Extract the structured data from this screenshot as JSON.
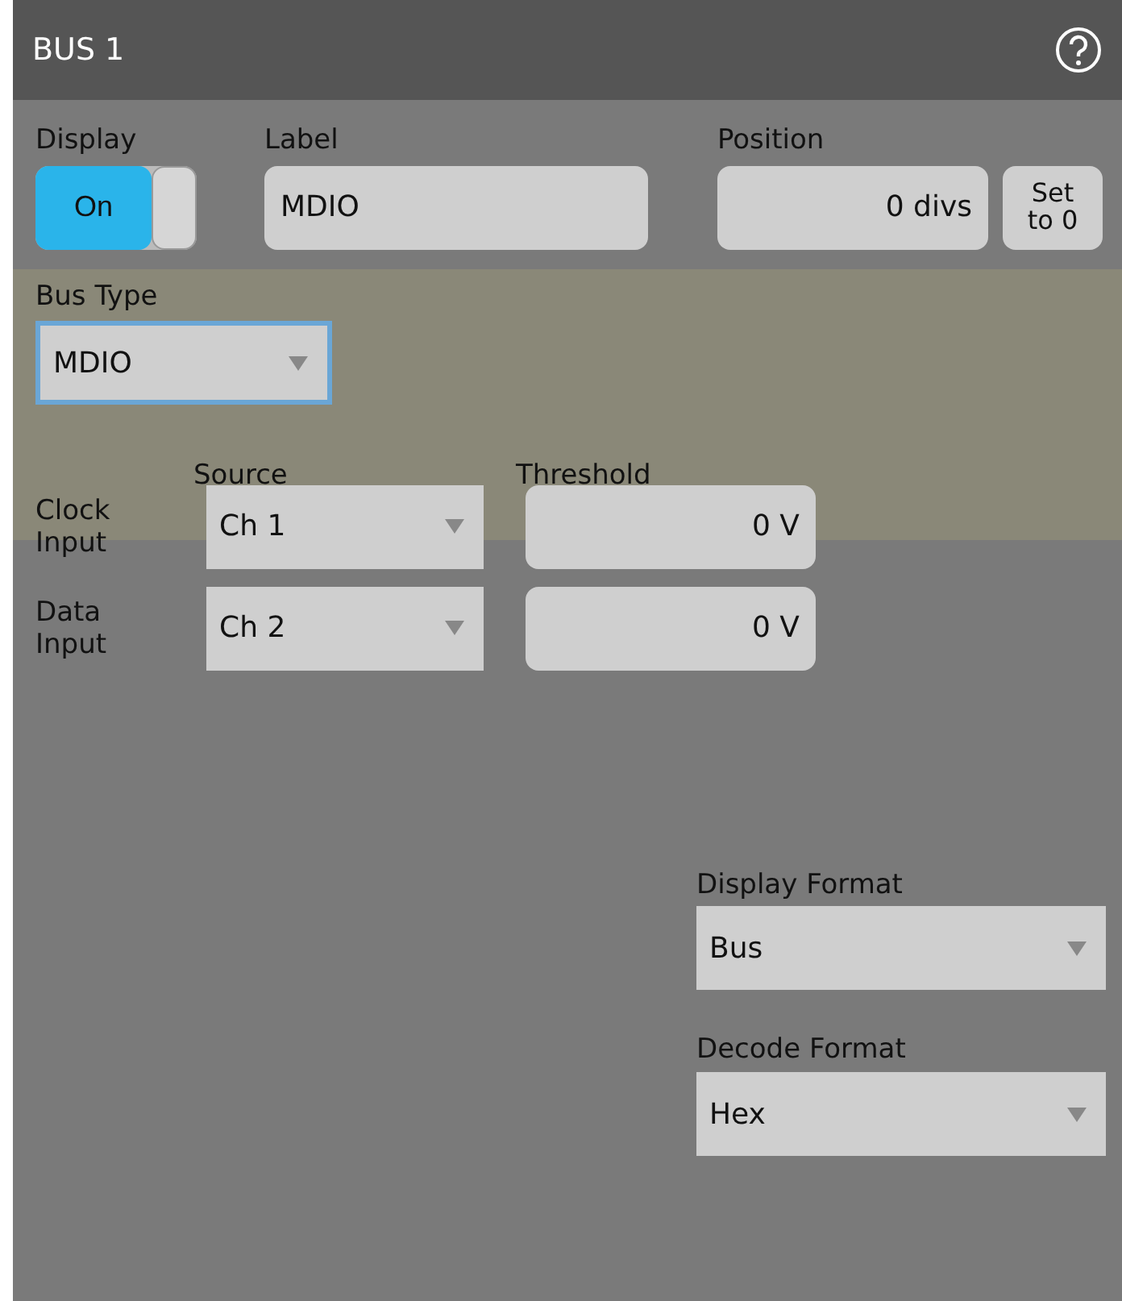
{
  "title": "BUS 1",
  "display": {
    "label": "Display",
    "toggle_text": "On",
    "on": true
  },
  "label_field": {
    "label": "Label",
    "value": "MDIO"
  },
  "position": {
    "label": "Position",
    "value": "0 divs",
    "button": "Set\nto 0"
  },
  "bus_type": {
    "label": "Bus Type",
    "value": "MDIO"
  },
  "inputs": {
    "source_header": "Source",
    "threshold_header": "Threshold",
    "rows": [
      {
        "label": "Clock\nInput",
        "source": "Ch 1",
        "threshold": "0 V"
      },
      {
        "label": "Data\nInput",
        "source": "Ch 2",
        "threshold": "0 V"
      }
    ]
  },
  "display_format": {
    "label": "Display Format",
    "value": "Bus"
  },
  "decode_format": {
    "label": "Decode Format",
    "value": "Hex"
  }
}
